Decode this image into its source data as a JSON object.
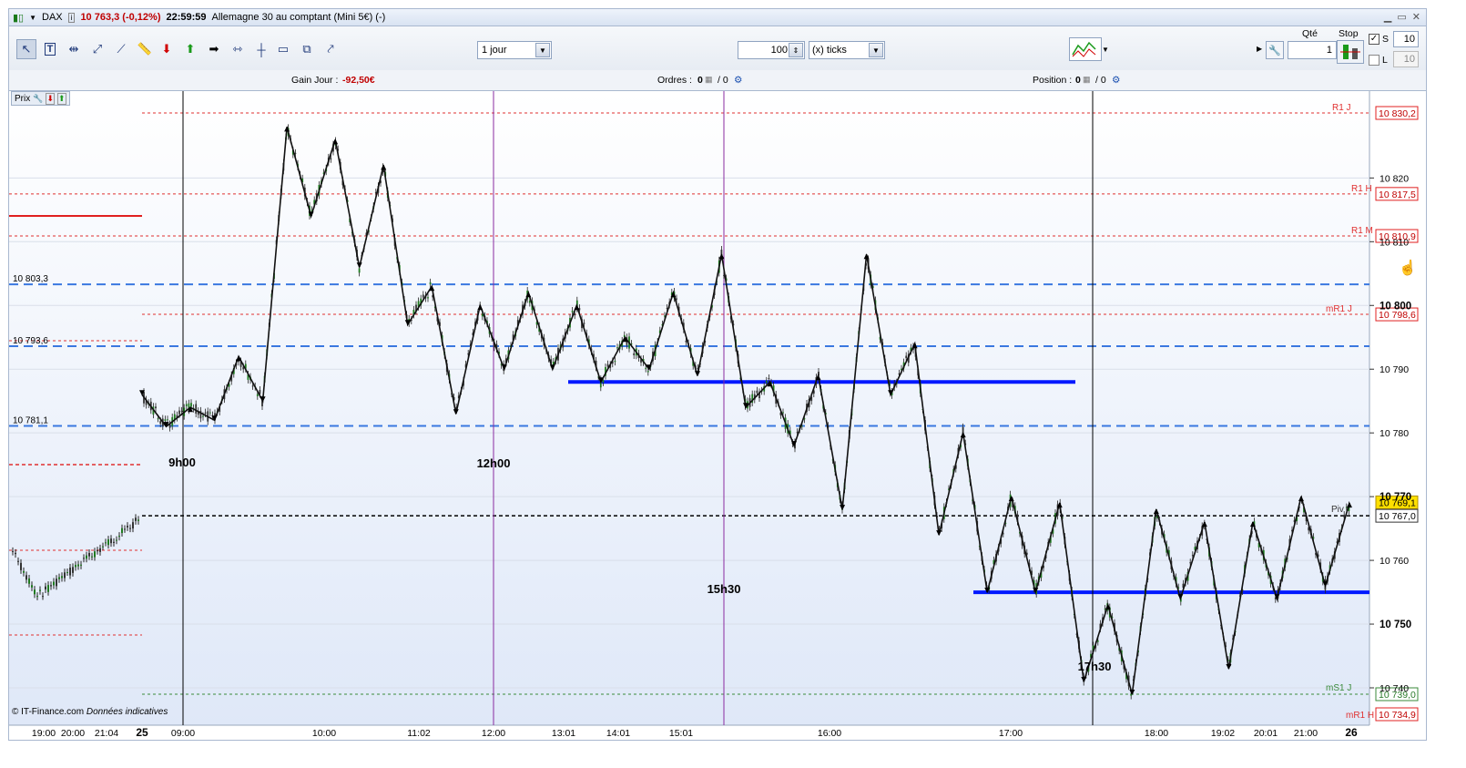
{
  "title_bar": {
    "symbol": "DAX",
    "last_quote": "10 763,3 (-0,12%)",
    "time": "22:59:59",
    "instrument": "Allemagne 30 au comptant (Mini 5€) (-)"
  },
  "toolbar": {
    "period_value": "1 jour",
    "ticks_count": "100",
    "ticks_unit": "(x) ticks",
    "qty_label": "Qté",
    "qty_value": "1",
    "stop_label": "Stop",
    "s_label": "S",
    "s_value": "10",
    "l_label": "L",
    "l_value": "10"
  },
  "info_bar": {
    "gain_label": "Gain Jour :",
    "gain_value": "-92,50€",
    "orders_label": "Ordres :",
    "orders_value": "0",
    "orders_value2": "/ 0",
    "position_label": "Position :",
    "position_value": "0",
    "position_value2": "/ 0"
  },
  "chart": {
    "panel_label": "Prix",
    "copyright": "© IT-Finance.com",
    "data_note": "Données indicatives",
    "level_labels_left": [
      "10 803,3",
      "10 793,6",
      "10 781,1"
    ],
    "level_tags_right": [
      "R1 J",
      "R1 H",
      "R1 M",
      "mR1 J",
      "Piv",
      "mS1 J",
      "mR1 H"
    ],
    "price_tags": [
      "10 830,2",
      "10 817,5",
      "10 810,9",
      "10 798,6",
      "10 769,1",
      "10 767,0",
      "10 739,0",
      "10 734,9"
    ],
    "y_axis_ticks": [
      "10 820",
      "10 810",
      "10 800",
      "10 790",
      "10 780",
      "10 770",
      "10 760",
      "10 750",
      "10 740"
    ],
    "x_axis_ticks": [
      "19:00",
      "20:00",
      "21:04",
      "25",
      "09:00",
      "10:00",
      "11:02",
      "12:00",
      "13:01",
      "14:01",
      "15:01",
      "16:00",
      "17:00",
      "18:00",
      "19:02",
      "20:01",
      "21:00",
      "26"
    ],
    "annotations": [
      "9h00",
      "12h00",
      "15h30",
      "17h30"
    ],
    "colors": {
      "candle_up": "#1f7a1f",
      "candle_down": "#333333",
      "pivot_levels": "#e03030",
      "support_levels": "#3a78e0",
      "thick_lines": "#0018ff",
      "session_line": "#8a2ba0",
      "last_price_tag": "#ffe000"
    }
  },
  "chart_data": {
    "type": "line",
    "title": "",
    "xlabel": "",
    "ylabel": "",
    "ylim": [
      10737,
      10832
    ],
    "series": [
      {
        "values": [
          10786,
          10781,
          10784,
          10782,
          10792,
          10785,
          10828,
          10814,
          10826,
          10806,
          10822,
          10797,
          10803,
          10783,
          10800,
          10790,
          10802,
          10790,
          10800,
          10788,
          10795,
          10790,
          10802,
          10789,
          10808,
          10784,
          10788,
          10778,
          10789,
          10768,
          10808,
          10786,
          10794,
          10764,
          10780,
          10755,
          10770,
          10755,
          10769,
          10741,
          10753,
          10739,
          10768,
          10754,
          10766,
          10743,
          10766,
          10754,
          10770,
          10756,
          10769
        ]
      }
    ],
    "levels": [
      10830.2,
      10817.5,
      10810.9,
      10803.3,
      10798.6,
      10793.6,
      10788.0,
      10781.1,
      10767.0,
      10755.0,
      10739.0,
      10734.9
    ],
    "last": 10769.1
  }
}
